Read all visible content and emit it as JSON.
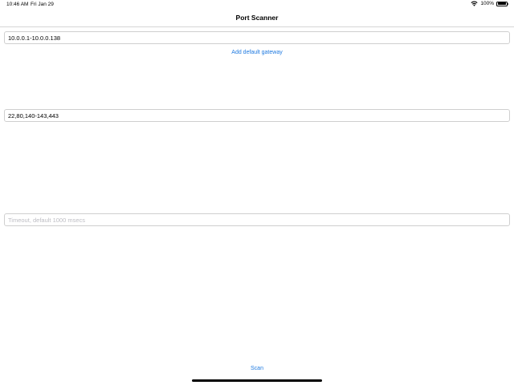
{
  "status_bar": {
    "time": "10:46 AM",
    "date": "Fri Jan 29",
    "battery": "100%"
  },
  "nav": {
    "title": "Port Scanner"
  },
  "form": {
    "ip_range_value": "10.0.0.1-10.0.0.138",
    "add_gateway_label": "Add default gateway",
    "ports_value": "22,80,140-143,443",
    "timeout_placeholder": "Timeout, default 1000 msecs",
    "scan_label": "Scan"
  },
  "colors": {
    "accent": "#1f7ae0",
    "placeholder": "#bdbdc3",
    "border": "#cfcfcf"
  },
  "icons": {
    "wifi": "wifi-icon",
    "battery": "battery-icon"
  }
}
